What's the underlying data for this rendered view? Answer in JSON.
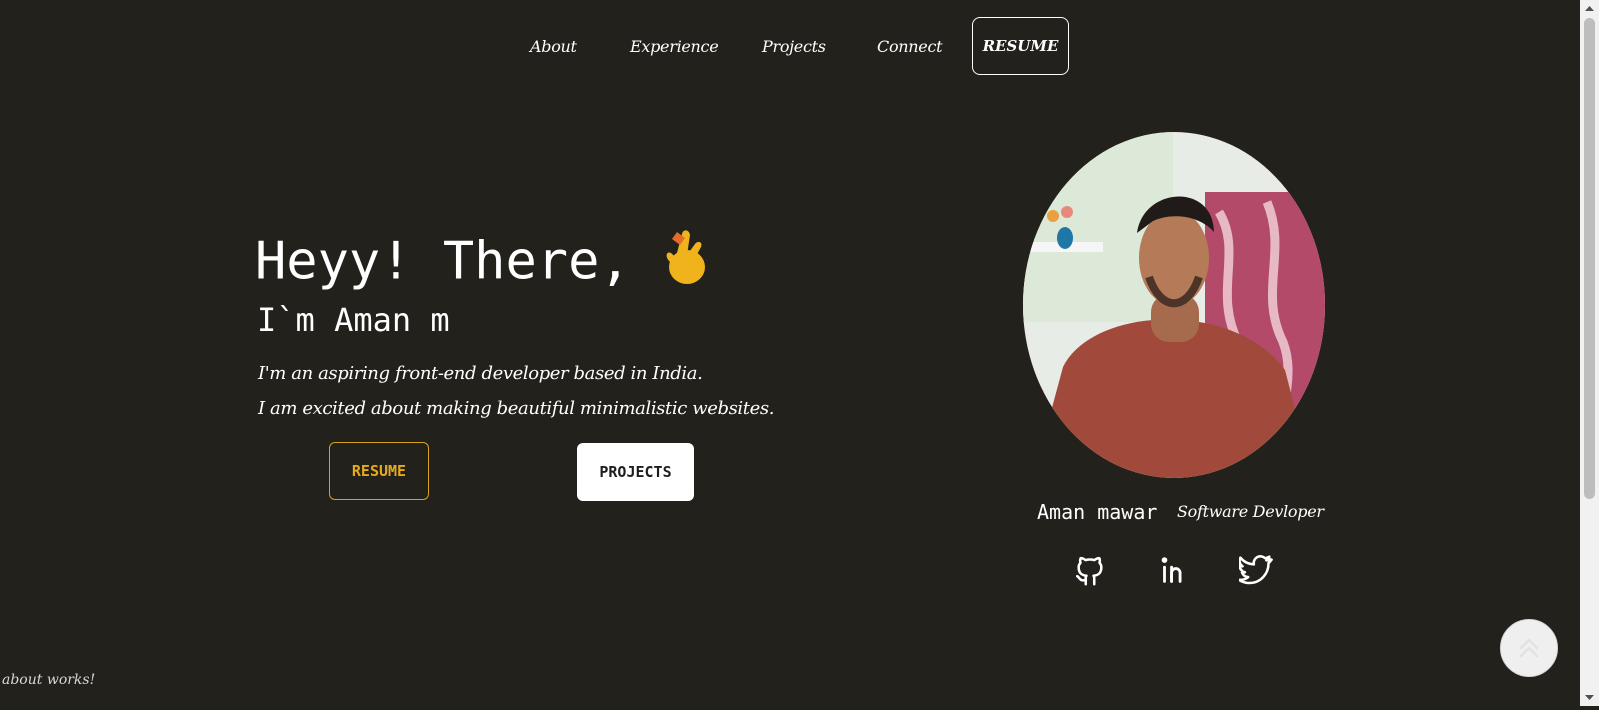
{
  "nav": {
    "links": [
      "About",
      "Experience",
      "Projects",
      "Connect"
    ],
    "resume": "RESUME"
  },
  "hero": {
    "title": "Heyy! There,",
    "subtitle": "I`m Aman m",
    "desc1": "I'm an aspiring front-end developer based in India.",
    "desc2": "I am excited about making beautiful minimalistic websites.",
    "resume_button": "RESUME",
    "projects_button": "PROJECTS"
  },
  "profile": {
    "name": "Aman mawar",
    "role": "Software Devloper"
  },
  "social": [
    "github-icon",
    "linkedin-icon",
    "twitter-icon"
  ],
  "footer": {
    "text": "about works!"
  },
  "colors": {
    "background": "#23211b",
    "accent": "#e6aa1e"
  }
}
